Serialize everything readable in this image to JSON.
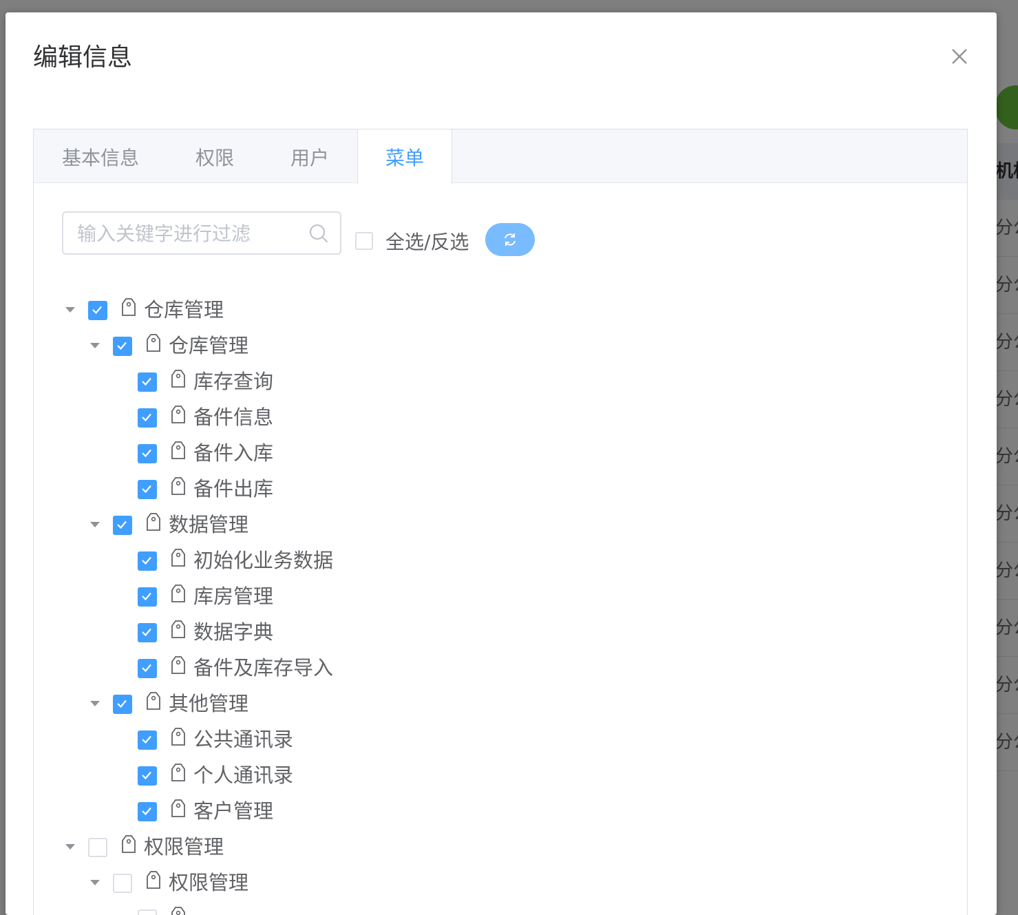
{
  "dialog": {
    "title": "编辑信息"
  },
  "tabs": [
    {
      "label": "基本信息",
      "active": false
    },
    {
      "label": "权限",
      "active": false
    },
    {
      "label": "用户",
      "active": false
    },
    {
      "label": "菜单",
      "active": true
    }
  ],
  "filter": {
    "placeholder": "输入关键字进行过滤",
    "value": ""
  },
  "select_all": {
    "label": "全选/反选",
    "checked": false
  },
  "tree": [
    {
      "label": "仓库管理",
      "level": 0,
      "checked": true,
      "expanded": true,
      "has_children": true
    },
    {
      "label": "仓库管理",
      "level": 1,
      "checked": true,
      "expanded": true,
      "has_children": true
    },
    {
      "label": "库存查询",
      "level": 2,
      "checked": true,
      "has_children": false
    },
    {
      "label": "备件信息",
      "level": 2,
      "checked": true,
      "has_children": false
    },
    {
      "label": "备件入库",
      "level": 2,
      "checked": true,
      "has_children": false
    },
    {
      "label": "备件出库",
      "level": 2,
      "checked": true,
      "has_children": false
    },
    {
      "label": "数据管理",
      "level": 1,
      "checked": true,
      "expanded": true,
      "has_children": true
    },
    {
      "label": "初始化业务数据",
      "level": 2,
      "checked": true,
      "has_children": false
    },
    {
      "label": "库房管理",
      "level": 2,
      "checked": true,
      "has_children": false
    },
    {
      "label": "数据字典",
      "level": 2,
      "checked": true,
      "has_children": false
    },
    {
      "label": "备件及库存导入",
      "level": 2,
      "checked": true,
      "has_children": false
    },
    {
      "label": "其他管理",
      "level": 1,
      "checked": true,
      "expanded": true,
      "has_children": true
    },
    {
      "label": "公共通讯录",
      "level": 2,
      "checked": true,
      "has_children": false
    },
    {
      "label": "个人通讯录",
      "level": 2,
      "checked": true,
      "has_children": false
    },
    {
      "label": "客户管理",
      "level": 2,
      "checked": true,
      "has_children": false
    },
    {
      "label": "权限管理",
      "level": 0,
      "checked": false,
      "expanded": true,
      "has_children": true
    },
    {
      "label": "权限管理",
      "level": 1,
      "checked": false,
      "expanded": true,
      "has_children": true
    },
    {
      "label": "",
      "level": 2,
      "checked": false,
      "has_children": false
    }
  ],
  "background": {
    "header_text": "机构",
    "row_text": "分公",
    "accent_green": "#67c23a"
  },
  "colors": {
    "primary": "#409eff",
    "primary_light": "#79bbff",
    "text": "#606266",
    "placeholder": "#c0c4cc",
    "border": "#dcdfe6"
  },
  "icons": {
    "close": "close-icon",
    "search": "search-icon",
    "refresh": "refresh-icon",
    "tree_node": "price-tag-icon",
    "expand": "caret-down-icon"
  }
}
